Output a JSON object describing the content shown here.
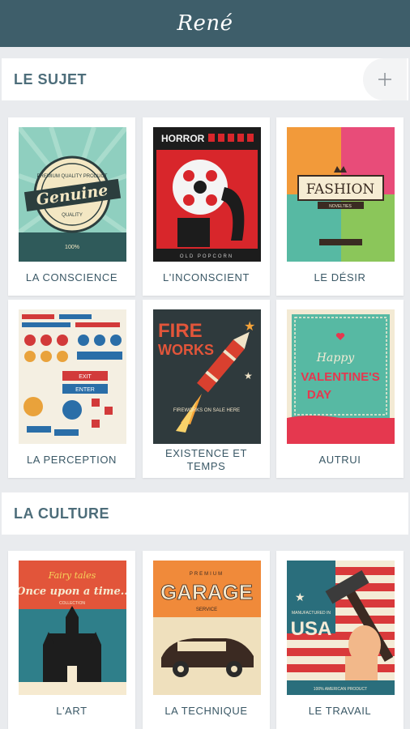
{
  "app": {
    "title": "René"
  },
  "sections": [
    {
      "label": "LE SUJET",
      "add_icon": "plus-icon",
      "cards": [
        {
          "caption": "LA CONSCIENCE",
          "poster": {
            "headline": "Genuine",
            "top_text": "PREMIUM QUALITY PRODUCT",
            "sub": "QUALITY",
            "badge": "100%"
          }
        },
        {
          "caption": "L'INCONSCIENT",
          "poster": {
            "headline": "HORROR",
            "bottom": "OLD POPCORN"
          }
        },
        {
          "caption": "LE DÉSIR",
          "poster": {
            "headline": "FASHION",
            "sub": "NOVELTIES"
          }
        },
        {
          "caption": "LA PERCEPTION",
          "poster": {
            "tags": [
              "EXIT",
              "ENTER"
            ]
          }
        },
        {
          "caption": "EXISTENCE ET TEMPS",
          "poster": {
            "headline_1": "FIRE",
            "headline_2": "WORKS",
            "sub": "FIREWORKS ON SALE HERE"
          }
        },
        {
          "caption": "AUTRUI",
          "poster": {
            "line_1": "Happy",
            "line_2": "VALENTINE'S",
            "line_3": "DAY"
          }
        }
      ]
    },
    {
      "label": "LA CULTURE",
      "cards": [
        {
          "caption": "L'ART",
          "poster": {
            "line_1": "Fairy tales",
            "line_2": "Once upon a time..",
            "sub": "COLLECTION"
          }
        },
        {
          "caption": "LA TECHNIQUE",
          "poster": {
            "top": "PREMIUM",
            "headline": "GARAGE",
            "sub": "SERVICE"
          }
        },
        {
          "caption": "LE TRAVAIL",
          "poster": {
            "top": "MANUFACTURED IN",
            "headline": "USA",
            "bottom": "100% AMERICAN PRODUCT"
          }
        }
      ]
    }
  ],
  "colors": {
    "appbar": "#3e5e6a",
    "header_text": "#4d6d7a",
    "caption_text": "#3a5866",
    "background": "#e9ebee"
  }
}
